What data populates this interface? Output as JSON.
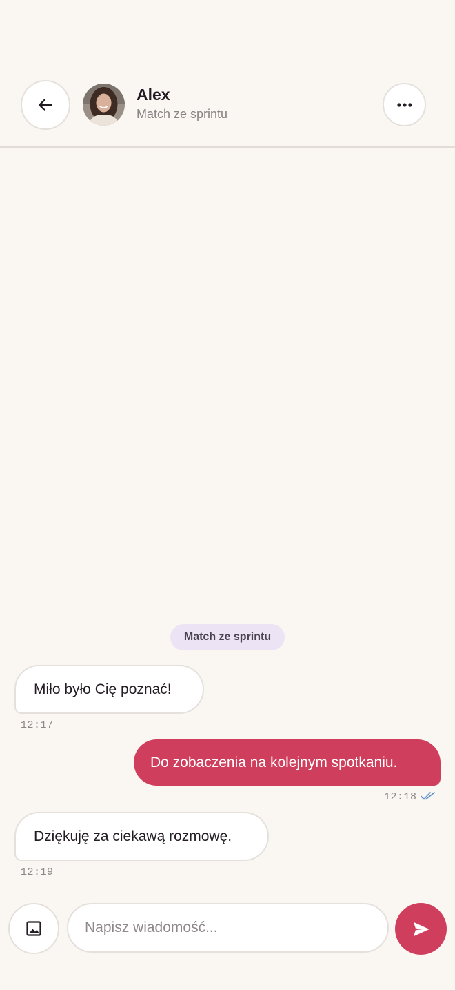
{
  "header": {
    "back_icon": "arrow-left-icon",
    "contact_name": "Alex",
    "contact_subtitle": "Match ze sprintu",
    "more_icon": "more-horizontal-icon"
  },
  "chat": {
    "badge": "Match ze sprintu",
    "messages": [
      {
        "direction": "incoming",
        "text": "Miło było Cię poznać!",
        "time": "12:17"
      },
      {
        "direction": "outgoing",
        "text": "Do zobaczenia na kolejnym spotkaniu.",
        "time": "12:18",
        "status_icon": "double-check-icon"
      },
      {
        "direction": "incoming",
        "text": "Dziękuję za ciekawą rozmowę.",
        "time": "12:19"
      }
    ]
  },
  "composer": {
    "image_icon": "image-icon",
    "placeholder": "Napisz wiadomość...",
    "value": "",
    "send_icon": "send-icon"
  },
  "colors": {
    "background": "#faf6f2",
    "accent": "#cf3f5d",
    "badge_bg": "#ece3f5",
    "read_tick": "#5b8fc7"
  }
}
